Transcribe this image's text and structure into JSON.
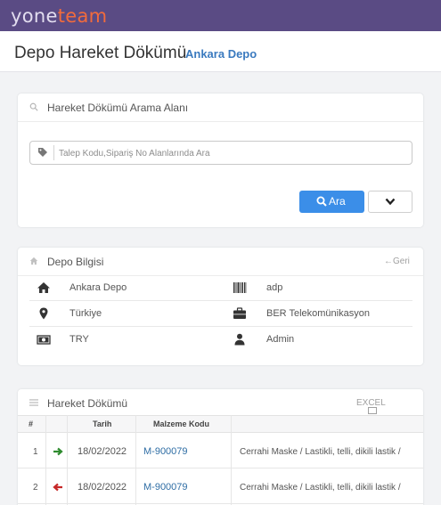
{
  "brand": {
    "part1": "yone",
    "part2": "team"
  },
  "page": {
    "title": "Depo Hareket Dökümü",
    "subtitle": "Ankara Depo"
  },
  "search": {
    "title": "Hareket Dökümü Arama Alanı",
    "placeholder": "Talep Kodu,Sipariş No Alanlarında Ara",
    "value": "",
    "button_label": "Ara"
  },
  "depo": {
    "title": "Depo Bilgisi",
    "back_label": "Geri",
    "rows": [
      {
        "left_icon": "home-icon",
        "left": "Ankara Depo",
        "right_icon": "barcode-icon",
        "right": "adp"
      },
      {
        "left_icon": "map-marker-icon",
        "left": "Türkiye",
        "right_icon": "briefcase-icon",
        "right": "BER Telekomünikasyon"
      },
      {
        "left_icon": "money-icon",
        "left": "TRY",
        "right_icon": "user-icon",
        "right": "Admin"
      }
    ]
  },
  "movements": {
    "title": "Hareket Dökümü",
    "excel_label": "EXCEL",
    "columns": [
      "#",
      "",
      "Tarih",
      "Malzeme Kodu",
      ""
    ],
    "rows": [
      {
        "no": "1",
        "direction": "in",
        "date": "18/02/2022",
        "code": "M-900079",
        "description": "Cerrahi Maske / Lastikli, telli, dikili lastik /"
      },
      {
        "no": "2",
        "direction": "out",
        "date": "18/02/2022",
        "code": "M-900079",
        "description": "Cerrahi Maske / Lastikli, telli, dikili lastik /"
      }
    ]
  },
  "colors": {
    "topbar": "#5a4b84",
    "brand_accent": "#f26b3c",
    "primary": "#3b8ee8",
    "link": "#2e6da4",
    "arrow_in": "#2e8b2e",
    "arrow_out": "#c62828"
  }
}
